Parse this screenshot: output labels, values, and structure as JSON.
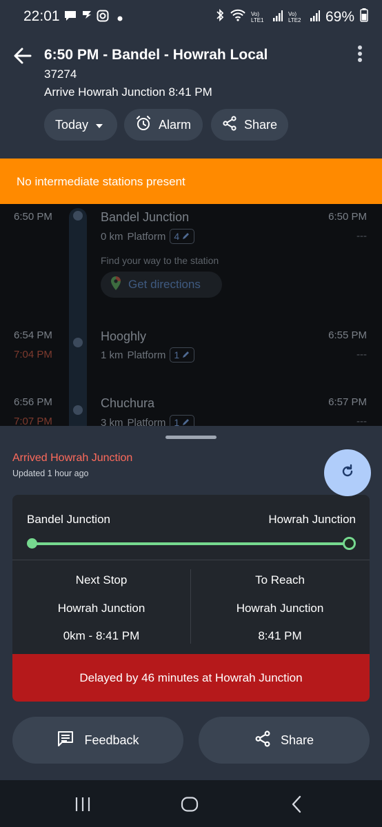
{
  "status_bar": {
    "time": "22:01",
    "battery": "69%",
    "sim1": "Vo) LTE1",
    "sim2": "Vo) LTE2"
  },
  "header": {
    "title": "6:50 PM - Bandel - Howrah Local",
    "train_number": "37274",
    "arrival": "Arrive Howrah Junction 8:41 PM",
    "chips": {
      "day": "Today",
      "alarm": "Alarm",
      "share": "Share"
    }
  },
  "banner": {
    "text": "No intermediate stations present",
    "color": "#ff8a00"
  },
  "timeline": {
    "find_way": "Find your way to the station",
    "directions_label": "Get directions",
    "platform_label": "Platform",
    "stations": [
      {
        "sched": "6:50 PM",
        "actual": "",
        "name": "Bandel Junction",
        "distance": "0 km",
        "platform": "4",
        "arr": "6:50 PM",
        "dep": "---"
      },
      {
        "sched": "6:54 PM",
        "actual": "7:04 PM",
        "name": "Hooghly",
        "distance": "1 km",
        "platform": "1",
        "arr": "6:55 PM",
        "dep": "---"
      },
      {
        "sched": "6:56 PM",
        "actual": "7:07 PM",
        "name": "Chuchura",
        "distance": "3 km",
        "platform": "1",
        "arr": "6:57 PM",
        "dep": "---"
      }
    ]
  },
  "sheet": {
    "status": "Arrived Howrah Junction",
    "updated": "Updated 1 hour ago",
    "from": "Bandel Junction",
    "to": "Howrah Junction",
    "progress_fraction": 1.0,
    "next_stop": {
      "heading": "Next Stop",
      "station": "Howrah Junction",
      "detail": "0km - 8:41 PM"
    },
    "to_reach": {
      "heading": "To Reach",
      "station": "Howrah Junction",
      "detail": "8:41 PM"
    },
    "delay": "Delayed by 46 minutes at Howrah Junction",
    "feedback_label": "Feedback",
    "share_label": "Share"
  },
  "colors": {
    "accent_progress": "#76d98f",
    "delay_bg": "#b5191b",
    "arrived_text": "#ff6b5c",
    "refresh_bg": "#b0cdfa"
  }
}
